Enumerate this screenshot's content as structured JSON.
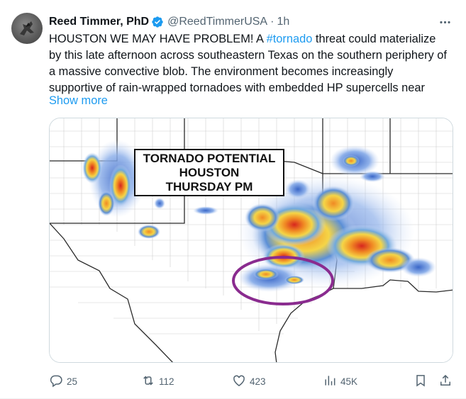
{
  "author": {
    "name": "Reed Timmer, PhD",
    "handle": "@ReedTimmerUSA",
    "separator": "·",
    "time": "1h"
  },
  "post": {
    "text_before": "HOUSTON WE MAY HAVE PROBLEM! A ",
    "hashtag": "#tornado",
    "text_after": " threat could materialize by this late afternoon across southeastern Texas on the southern periphery of a massive convective blob. The environment becomes increasingly supportive of rain-wrapped tornadoes with embedded HP supercells near",
    "show_more": "Show more"
  },
  "media": {
    "line1": "TORNADO POTENTIAL",
    "line2": "HOUSTON",
    "line3": "THURSDAY PM",
    "highlight_color": "#8a2b8f"
  },
  "actions": {
    "replies": "25",
    "reposts": "112",
    "likes": "423",
    "views": "45K"
  },
  "icons": {
    "verified": "verified-badge-icon",
    "more": "more-options-icon",
    "reply": "reply-icon",
    "repost": "repost-icon",
    "like": "like-icon",
    "views": "views-icon",
    "bookmark": "bookmark-icon",
    "share": "share-icon"
  },
  "colors": {
    "accent": "#1d9bf0",
    "secondary_text": "#536471",
    "primary_text": "#0f1419"
  }
}
